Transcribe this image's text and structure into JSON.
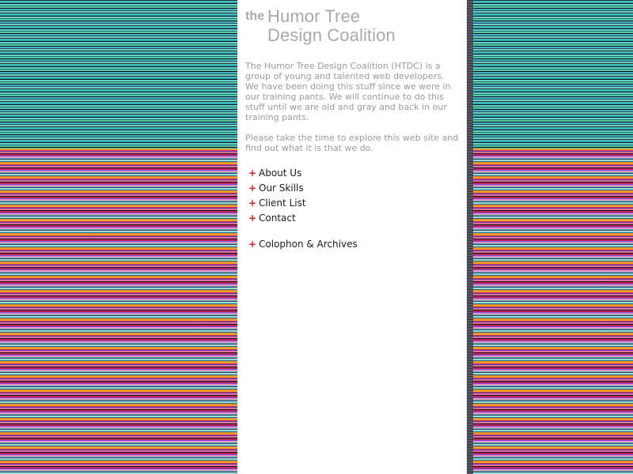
{
  "brand": {
    "the": "the",
    "name_line1": "Humor Tree",
    "name_line2": "Design Coalition"
  },
  "intro": {
    "paragraph1": "The Humor Tree Design Coalition (HTDC) is a group of young and talented web developers. We have been doing this stuff since we were in our training pants. We will continue to do this stuff until we are old and gray and back in our training pants.",
    "paragraph2": "Please take the time to explore this web site and find out what it is that we do."
  },
  "nav": {
    "bullet": "+",
    "items": [
      {
        "label": "About Us"
      },
      {
        "label": "Our Skills"
      },
      {
        "label": "Client List"
      },
      {
        "label": "Contact"
      }
    ],
    "extra": {
      "label": "Colophon & Archives"
    }
  },
  "colors": {
    "text_muted": "#9a9a9a",
    "link_text": "#1a1a1a",
    "bullet_red": "#cc1f2a",
    "background": "#ffffff"
  }
}
